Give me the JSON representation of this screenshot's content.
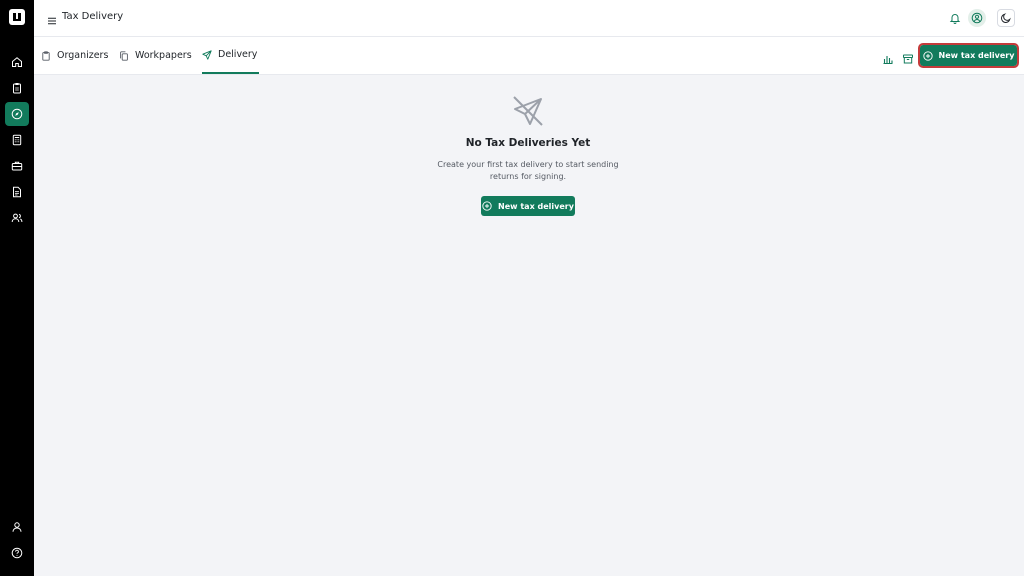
{
  "header": {
    "title": "Tax Delivery"
  },
  "tabs": [
    {
      "label": "Organizers"
    },
    {
      "label": "Workpapers"
    },
    {
      "label": "Delivery"
    }
  ],
  "toolbar": {
    "new_button_label": "New tax delivery"
  },
  "empty_state": {
    "title": "No Tax Deliveries Yet",
    "description": "Create your first tax delivery to start sending returns for signing.",
    "button_label": "New tax delivery"
  },
  "sidebar": {
    "items": [
      {
        "icon": "home-icon"
      },
      {
        "icon": "clipboard-icon"
      },
      {
        "icon": "compass-icon",
        "active": true
      },
      {
        "icon": "calculator-icon"
      },
      {
        "icon": "briefcase-icon"
      },
      {
        "icon": "file-text-icon"
      },
      {
        "icon": "users-icon"
      }
    ],
    "bottom": [
      {
        "icon": "user-icon"
      },
      {
        "icon": "help-icon"
      }
    ]
  },
  "colors": {
    "accent": "#127b5c",
    "sidebar_bg": "#000000",
    "page_bg": "#f3f4f7",
    "highlight_outline": "#c53b3b"
  }
}
